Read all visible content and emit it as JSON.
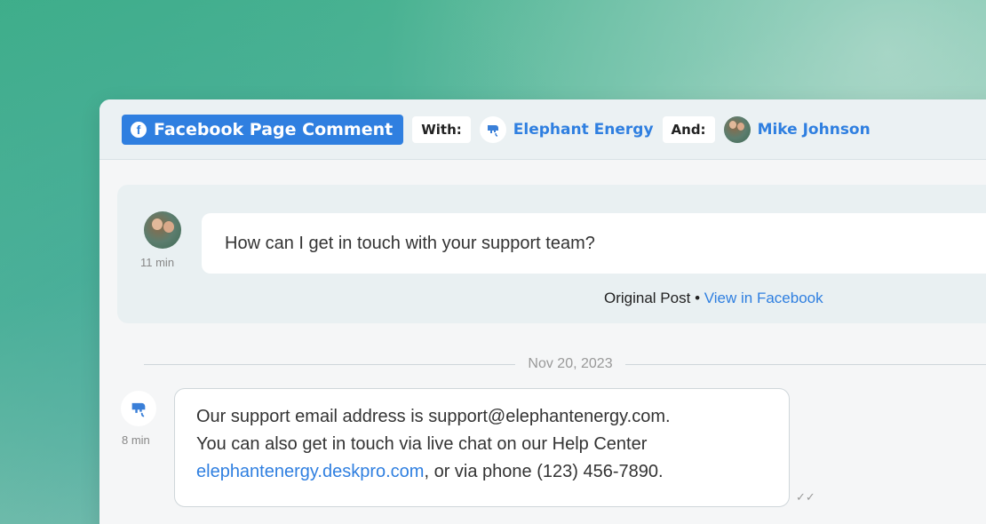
{
  "header": {
    "channel_label": "Facebook Page Comment",
    "with_label": "With:",
    "brand_name": "Elephant Energy",
    "and_label": "And:",
    "user_name": "Mike Johnson"
  },
  "post": {
    "time": "11 min",
    "text": "How can I get in touch with your support team?",
    "original_post_label": "Original Post",
    "separator": "•",
    "view_link": "View in Facebook"
  },
  "divider": {
    "date": "Nov 20, 2023"
  },
  "reply": {
    "time": "8 min",
    "line1": "Our support email address is support@elephantenergy.com.",
    "line2": "You can also get in touch via live chat on our Help Center",
    "link": "elephantenergy.deskpro.com",
    "line3_rest": ", or via phone (123) 456-7890."
  },
  "colors": {
    "accent": "#2f7fe0",
    "brand_icon": "#3a7fd8"
  },
  "icons": {
    "channel": "facebook-icon",
    "brand": "elephant-logo-icon",
    "read": "double-check-icon"
  }
}
